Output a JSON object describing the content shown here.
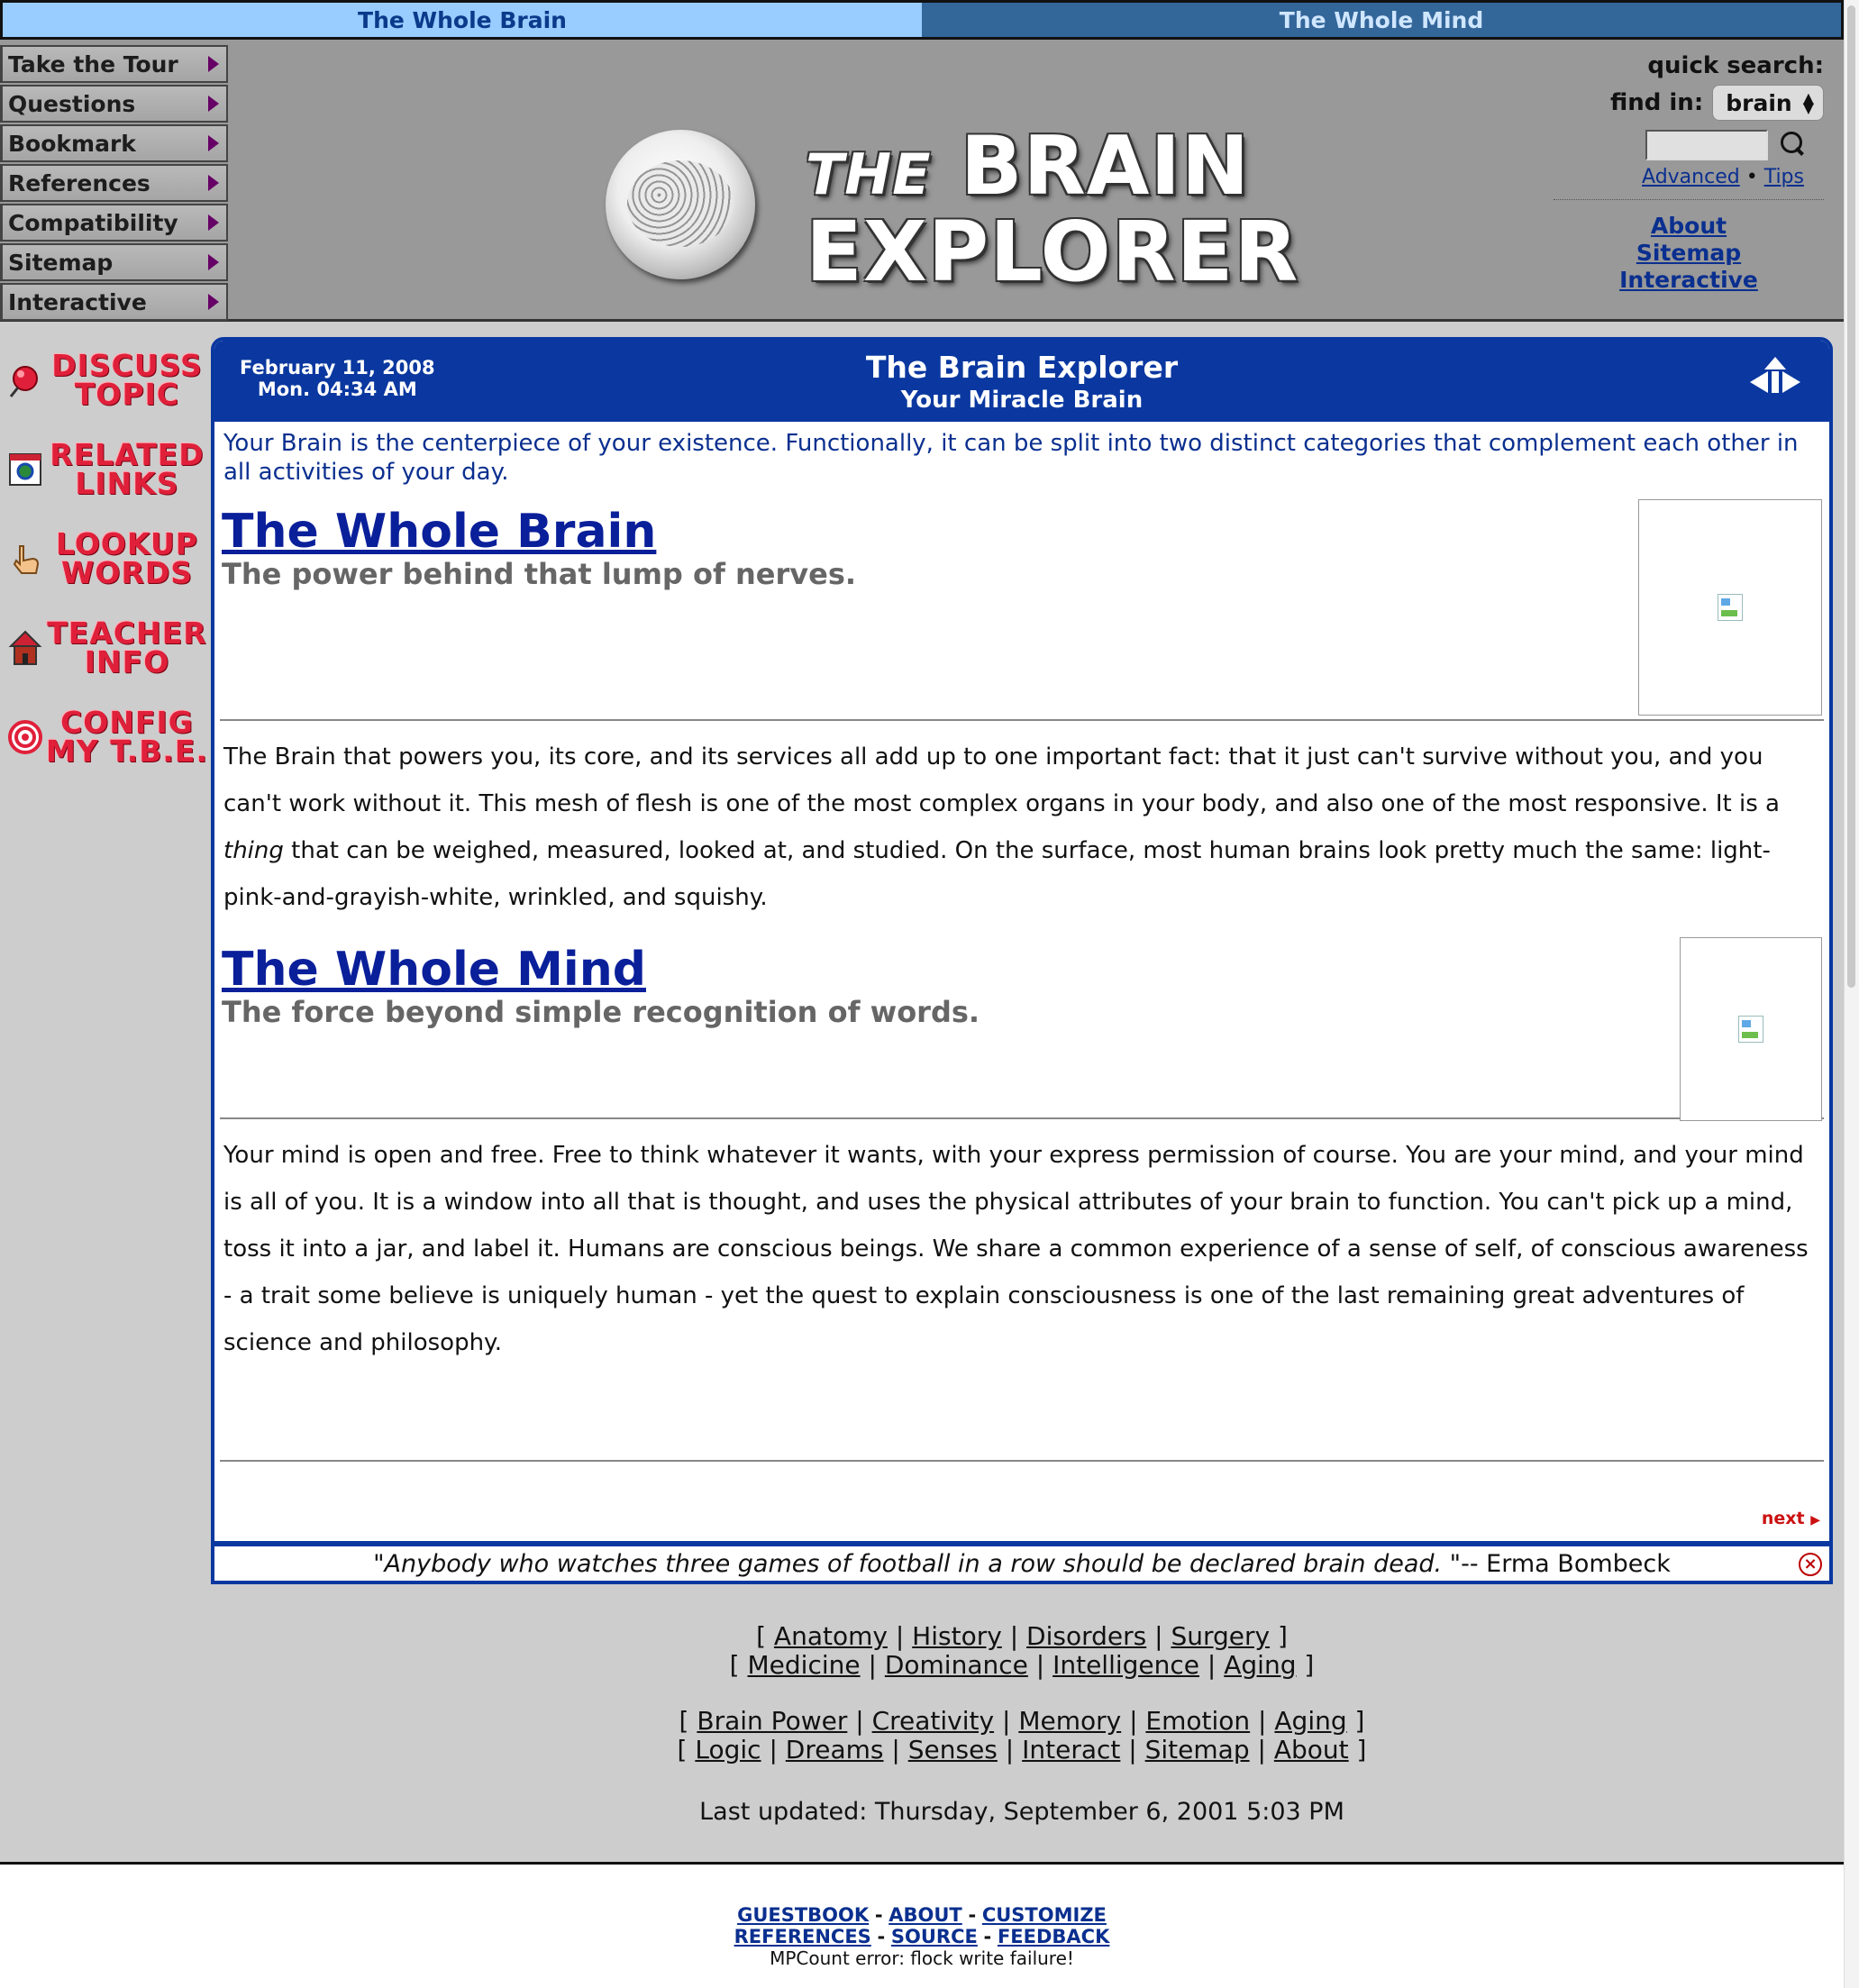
{
  "tabs": {
    "brain": "The Whole Brain",
    "mind": "The Whole Mind"
  },
  "menu": [
    {
      "label": "Take the Tour"
    },
    {
      "label": "Questions"
    },
    {
      "label": "Bookmark"
    },
    {
      "label": "References"
    },
    {
      "label": "Compatibility"
    },
    {
      "label": "Sitemap"
    },
    {
      "label": "Interactive"
    }
  ],
  "logo": {
    "the": "THE",
    "brain": "BRAIN",
    "explorer": "EXPLORER"
  },
  "quick_search": {
    "title": "quick search:",
    "find_in_label": "find in:",
    "find_in_value": "brain",
    "search_value": "",
    "advanced": "Advanced",
    "bullet": "•",
    "tips": "Tips",
    "nav": [
      "About",
      "Sitemap",
      "Interactive"
    ]
  },
  "side_links": [
    {
      "line1": "DISCUSS",
      "line2": "TOPIC",
      "icon": "pushpin-icon"
    },
    {
      "line1": "RELATED",
      "line2": "LINKS",
      "icon": "document-icon"
    },
    {
      "line1": "LOOKUP",
      "line2": "WORDS",
      "icon": "pointing-hand-icon"
    },
    {
      "line1": "TEACHER",
      "line2": "INFO",
      "icon": "schoolhouse-icon"
    },
    {
      "line1": "CONFIG",
      "line2": "MY T.B.E.",
      "icon": "target-icon"
    }
  ],
  "panel": {
    "date": "February 11, 2008",
    "time": "Mon. 04:34 AM",
    "title": "The Brain Explorer",
    "subtitle": "Your Miracle Brain",
    "intro": "Your Brain is the centerpiece of your existence. Functionally, it can be split into two distinct categories that complement each other in all activities of your day.",
    "sections": [
      {
        "heading": "The Whole Brain",
        "sub": "The power behind that lump of nerves.",
        "body_a": "The Brain that powers you, its core, and its services all add up to one important fact: that it just can't survive without you, and you can't work without it. This mesh of flesh is one of the most complex organs in your body, and also one of the most responsive. It is a ",
        "body_em": "thing",
        "body_b": " that can be weighed, measured, looked at, and studied. On the surface, most human brains look pretty much the same: light-pink-and-grayish-white, wrinkled, and squishy."
      },
      {
        "heading": "The Whole Mind",
        "sub": "The force beyond simple recognition of words.",
        "body": "Your mind is open and free. Free to think whatever it wants, with your express permission of course. You are your mind, and your mind is all of you. It is a window into all that is thought, and uses the physical attributes of your brain to function. You can't pick up a mind, toss it into a jar, and label it. Humans are conscious beings. We share a common experience of a sense of self, of conscious awareness - a trait some believe is uniquely human - yet the quest to explain consciousness is one of the last remaining great adventures of science and philosophy."
      }
    ],
    "next": "next"
  },
  "quote": {
    "text": "\"Anybody who watches three games of football in a row should be declared brain dead. \"",
    "author": " -- Erma Bombeck"
  },
  "footer_groups": [
    [
      [
        "Anatomy",
        "History",
        "Disorders",
        "Surgery"
      ],
      [
        "Medicine",
        "Dominance",
        "Intelligence",
        "Aging"
      ]
    ],
    [
      [
        "Brain Power",
        "Creativity",
        "Memory",
        "Emotion",
        "Aging"
      ],
      [
        "Logic",
        "Dreams",
        "Senses",
        "Interact",
        "Sitemap",
        "About"
      ]
    ]
  ],
  "last_updated": "Last updated: Thursday, September 6, 2001 5:03 PM",
  "bottom": {
    "row1": [
      "GUESTBOOK",
      "ABOUT",
      "CUSTOMIZE"
    ],
    "row2": [
      "REFERENCES",
      "SOURCE",
      "FEEDBACK"
    ],
    "error": "MPCount error: flock write failure!"
  },
  "colors": {
    "panel_blue": "#0a38a0",
    "side_link_red": "#e0203a",
    "tab_light": "#99ccff",
    "tab_dark": "#336699"
  }
}
